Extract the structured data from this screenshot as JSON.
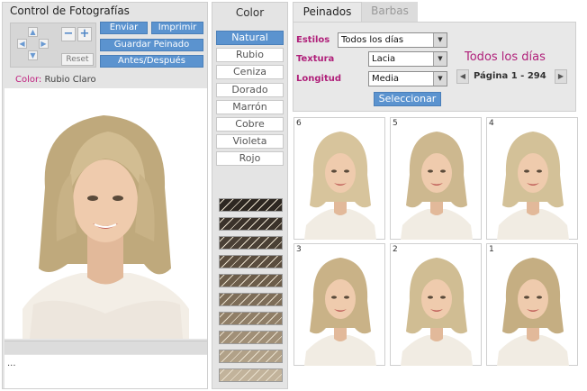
{
  "left_panel": {
    "title": "Control de Fotografías",
    "send_label": "Enviar",
    "print_label": "Imprimir",
    "save_style_label": "Guardar Peinado",
    "before_after_label": "Antes/Después",
    "reset_label": "Reset",
    "zoom_out_symbol": "−",
    "zoom_in_symbol": "+",
    "color_key": "Color:",
    "color_value": "Rubio Claro",
    "log_text": "..."
  },
  "color_panel": {
    "title": "Color",
    "options": [
      "Natural",
      "Rubio",
      "Ceniza",
      "Dorado",
      "Marrón",
      "Cobre",
      "Violeta",
      "Rojo"
    ],
    "selected": "Natural",
    "shades": [
      "#2d2721",
      "#3a322a",
      "#4a4035",
      "#5a4d3e",
      "#6c5d4a",
      "#7d6d58",
      "#8f7e67",
      "#a08f77",
      "#b1a188",
      "#c2b39b"
    ]
  },
  "tabs": [
    {
      "label": "Peinados",
      "active": true
    },
    {
      "label": "Barbas",
      "active": false
    }
  ],
  "filters": {
    "styles_label": "Estilos",
    "styles_value": "Todos los días",
    "texture_label": "Textura",
    "texture_value": "Lacia",
    "length_label": "Longitud",
    "length_value": "Media",
    "select_button": "Seleccionar"
  },
  "results": {
    "heading": "Todos los días",
    "page_text": "Página 1 - 294",
    "prev_icon": "triangle-left-icon",
    "next_icon": "triangle-right-icon"
  },
  "thumbnails": [
    {
      "number": "6"
    },
    {
      "number": "5"
    },
    {
      "number": "4"
    },
    {
      "number": "3"
    },
    {
      "number": "2"
    },
    {
      "number": "1"
    }
  ],
  "colors": {
    "accent_blue": "#5b93cf",
    "label_magenta": "#b0207a",
    "panel_gray": "#e4e4e4",
    "hair_blonde": "#c9b48a"
  }
}
